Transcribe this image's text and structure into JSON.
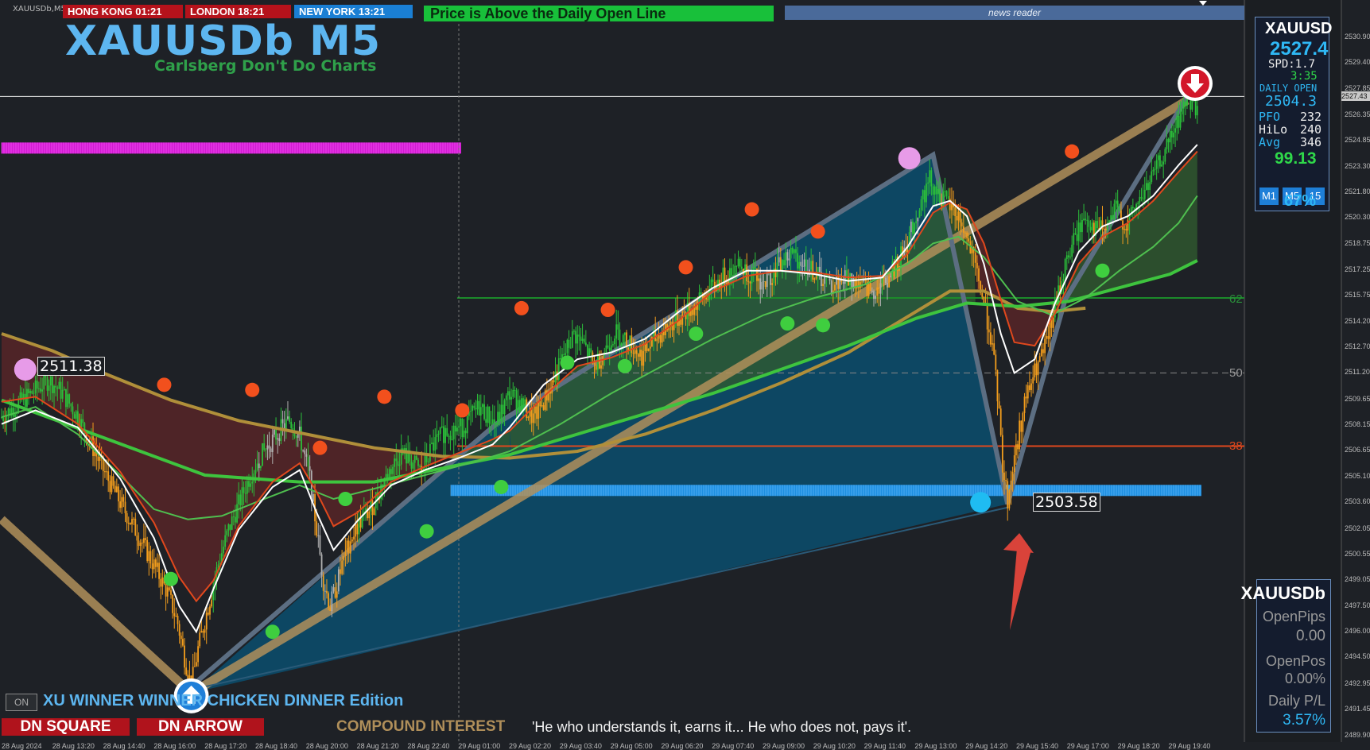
{
  "window": {
    "symbol_label": "XAUUSDb,M5"
  },
  "sessions": [
    {
      "label": "HONG KONG 01:21",
      "color": "#b5121b"
    },
    {
      "label": "LONDON  18:21",
      "color": "#b5121b"
    },
    {
      "label": "NEW YORK  13:21",
      "color": "#1a7fd4"
    }
  ],
  "status_text": "Price is Above the Daily Open Line",
  "news_reader": "news reader",
  "chart_title": "XAUUSDb M5",
  "chart_subtitle": "Carlsberg Don't Do Charts",
  "info_panel": {
    "symbol": "XAUUSD",
    "price": "2527.4",
    "spread": "SPD:1.7",
    "timer": "3:35",
    "daily_open_label": "DAILY OPEN",
    "daily_open_value": "2504.3",
    "pfo_label": "PFO",
    "pfo_value": "232",
    "hilo_label": "HiLo",
    "hilo_value": "240",
    "avg_label": "Avg",
    "avg_value": "346",
    "score": "99.13",
    "timeframes": [
      "M1",
      "M5",
      "15"
    ],
    "percent": "67%"
  },
  "position_panel": {
    "symbol": "XAUUSDb",
    "open_pips_label": "OpenPips",
    "open_pips_value": "0.00",
    "open_pos_label": "OpenPos",
    "open_pos_value": "0.00%",
    "daily_pl_label": "Daily P/L",
    "daily_pl_value": "3.57%"
  },
  "labels": {
    "swing_high": "2511.38",
    "swing_low": "2503.58"
  },
  "fib_levels": [
    "62",
    "50",
    "38"
  ],
  "bottom": {
    "on_button": "ON",
    "edition": "XU WINNER WINNER CHICKEN DINNER Edition",
    "dn_square": "DN SQUARE",
    "dn_arrow": "DN ARROW",
    "compound": "COMPOUND INTEREST",
    "quote": "'He who understands it, earns it... He who does not, pays it'."
  },
  "time_axis": [
    "28 Aug 2024",
    "28 Aug 13:20",
    "28 Aug 14:40",
    "28 Aug 16:00",
    "28 Aug 17:20",
    "28 Aug 18:40",
    "28 Aug 20:00",
    "28 Aug 21:20",
    "28 Aug 22:40",
    "29 Aug 01:00",
    "29 Aug 02:20",
    "29 Aug 03:40",
    "29 Aug 05:00",
    "29 Aug 06:20",
    "29 Aug 07:40",
    "29 Aug 09:00",
    "29 Aug 10:20",
    "29 Aug 11:40",
    "29 Aug 13:00",
    "29 Aug 14:20",
    "29 Aug 15:40",
    "29 Aug 17:00",
    "29 Aug 18:20",
    "29 Aug 19:40"
  ],
  "price_axis": [
    "2530.90",
    "2529.40",
    "2527.85",
    "2526.35",
    "2524.85",
    "2523.30",
    "2521.80",
    "2520.30",
    "2518.75",
    "2517.25",
    "2515.75",
    "2514.20",
    "2512.70",
    "2511.20",
    "2509.65",
    "2508.15",
    "2506.65",
    "2505.10",
    "2503.60",
    "2502.05",
    "2500.55",
    "2499.05",
    "2497.50",
    "2496.00",
    "2494.50",
    "2492.95",
    "2491.45",
    "2489.90"
  ],
  "current_price_tag": "2527.43",
  "chart_data": {
    "type": "candlestick",
    "symbol": "XAUUSDb",
    "timeframe": "M5",
    "ylim": [
      2489.9,
      2531.6
    ],
    "y_ticks": [
      2530.9,
      2529.4,
      2527.85,
      2526.35,
      2524.85,
      2523.3,
      2521.8,
      2520.3,
      2518.75,
      2517.25,
      2515.75,
      2514.2,
      2512.7,
      2511.2,
      2509.65,
      2508.15,
      2506.65,
      2505.1,
      2503.6,
      2502.05,
      2500.55,
      2499.05,
      2497.5,
      2496.0,
      2494.5,
      2492.95,
      2491.45,
      2489.9
    ],
    "close_path": [
      [
        0,
        2508.6
      ],
      [
        10,
        2509.4
      ],
      [
        20,
        2510.2
      ],
      [
        28,
        2510.8
      ],
      [
        36,
        2510.0
      ],
      [
        44,
        2508.8
      ],
      [
        52,
        2507.2
      ],
      [
        60,
        2505.5
      ],
      [
        70,
        2503.6
      ],
      [
        80,
        2501.8
      ],
      [
        90,
        2499.9
      ],
      [
        98,
        2498.3
      ],
      [
        104,
        2496.5
      ],
      [
        108,
        2494.5
      ],
      [
        112,
        2492.8
      ],
      [
        116,
        2495.0
      ],
      [
        122,
        2497.5
      ],
      [
        128,
        2500.0
      ],
      [
        134,
        2502.0
      ],
      [
        140,
        2503.5
      ],
      [
        146,
        2505.0
      ],
      [
        152,
        2506.2
      ],
      [
        158,
        2507.0
      ],
      [
        164,
        2507.8
      ],
      [
        170,
        2508.4
      ],
      [
        176,
        2507.5
      ],
      [
        182,
        2505.0
      ],
      [
        186,
        2502.0
      ],
      [
        190,
        2499.0
      ],
      [
        194,
        2497.5
      ],
      [
        200,
        2499.5
      ],
      [
        206,
        2501.5
      ],
      [
        212,
        2502.5
      ],
      [
        218,
        2503.2
      ],
      [
        224,
        2504.5
      ],
      [
        230,
        2505.6
      ],
      [
        236,
        2506.5
      ],
      [
        242,
        2506.0
      ],
      [
        248,
        2505.4
      ],
      [
        254,
        2506.8
      ],
      [
        262,
        2507.8
      ],
      [
        272,
        2508.0
      ],
      [
        282,
        2509.2
      ],
      [
        292,
        2508.2
      ],
      [
        300,
        2510.0
      ],
      [
        308,
        2509.2
      ],
      [
        314,
        2508.5
      ],
      [
        320,
        2509.5
      ],
      [
        326,
        2510.8
      ],
      [
        332,
        2512.2
      ],
      [
        338,
        2513.5
      ],
      [
        344,
        2512.8
      ],
      [
        350,
        2511.6
      ],
      [
        356,
        2512.5
      ],
      [
        362,
        2513.6
      ],
      [
        370,
        2513.0
      ],
      [
        378,
        2512.2
      ],
      [
        386,
        2513.2
      ],
      [
        394,
        2514.0
      ],
      [
        402,
        2514.6
      ],
      [
        410,
        2515.2
      ],
      [
        418,
        2516.0
      ],
      [
        426,
        2516.8
      ],
      [
        434,
        2517.6
      ],
      [
        442,
        2517.0
      ],
      [
        450,
        2516.4
      ],
      [
        458,
        2517.4
      ],
      [
        466,
        2518.2
      ],
      [
        474,
        2517.6
      ],
      [
        482,
        2516.9
      ],
      [
        490,
        2516.3
      ],
      [
        498,
        2516.8
      ],
      [
        506,
        2516.4
      ],
      [
        514,
        2516.0
      ],
      [
        522,
        2516.6
      ],
      [
        530,
        2517.8
      ],
      [
        536,
        2519.2
      ],
      [
        542,
        2521.0
      ],
      [
        548,
        2522.6
      ],
      [
        554,
        2521.6
      ],
      [
        560,
        2521.0
      ],
      [
        566,
        2520.2
      ],
      [
        572,
        2518.4
      ],
      [
        578,
        2516.2
      ],
      [
        584,
        2513.4
      ],
      [
        588,
        2510.0
      ],
      [
        591,
        2505.8
      ],
      [
        594,
        2503.7
      ],
      [
        598,
        2506.2
      ],
      [
        604,
        2509.4
      ],
      [
        610,
        2511.2
      ],
      [
        616,
        2512.6
      ],
      [
        622,
        2515.0
      ],
      [
        628,
        2517.5
      ],
      [
        634,
        2519.2
      ],
      [
        640,
        2520.4
      ],
      [
        646,
        2519.6
      ],
      [
        652,
        2519.6
      ],
      [
        658,
        2520.8
      ],
      [
        664,
        2519.8
      ],
      [
        670,
        2521.0
      ],
      [
        676,
        2522.0
      ],
      [
        682,
        2523.2
      ],
      [
        688,
        2524.4
      ],
      [
        694,
        2525.8
      ],
      [
        700,
        2527.4
      ],
      [
        706,
        2526.8
      ]
    ],
    "ma_white": [
      [
        0,
        2508.2
      ],
      [
        20,
        2509.0
      ],
      [
        45,
        2508.0
      ],
      [
        70,
        2505.0
      ],
      [
        90,
        2501.5
      ],
      [
        105,
        2497.5
      ],
      [
        115,
        2496.0
      ],
      [
        125,
        2498.5
      ],
      [
        140,
        2502.0
      ],
      [
        160,
        2504.5
      ],
      [
        176,
        2505.5
      ],
      [
        186,
        2503.0
      ],
      [
        196,
        2500.8
      ],
      [
        210,
        2502.5
      ],
      [
        230,
        2504.6
      ],
      [
        250,
        2505.5
      ],
      [
        270,
        2506.2
      ],
      [
        290,
        2507.0
      ],
      [
        300,
        2508.0
      ],
      [
        320,
        2510.5
      ],
      [
        340,
        2512.0
      ],
      [
        360,
        2512.4
      ],
      [
        380,
        2513.2
      ],
      [
        400,
        2514.8
      ],
      [
        420,
        2516.2
      ],
      [
        440,
        2517.2
      ],
      [
        460,
        2517.2
      ],
      [
        480,
        2517.0
      ],
      [
        500,
        2516.6
      ],
      [
        520,
        2516.8
      ],
      [
        535,
        2518.6
      ],
      [
        550,
        2521.0
      ],
      [
        560,
        2521.3
      ],
      [
        570,
        2520.4
      ],
      [
        580,
        2517.6
      ],
      [
        590,
        2513.5
      ],
      [
        598,
        2511.2
      ],
      [
        610,
        2512.0
      ],
      [
        622,
        2515.3
      ],
      [
        636,
        2518.3
      ],
      [
        650,
        2519.8
      ],
      [
        665,
        2520.4
      ],
      [
        680,
        2521.6
      ],
      [
        695,
        2523.4
      ],
      [
        706,
        2524.6
      ]
    ],
    "ma_orange": [
      [
        0,
        2509.5
      ],
      [
        20,
        2509.8
      ],
      [
        45,
        2508.2
      ],
      [
        70,
        2505.4
      ],
      [
        90,
        2502.4
      ],
      [
        105,
        2499.2
      ],
      [
        115,
        2497.8
      ],
      [
        125,
        2499.0
      ],
      [
        140,
        2502.2
      ],
      [
        160,
        2504.8
      ],
      [
        176,
        2505.9
      ],
      [
        186,
        2504.2
      ],
      [
        196,
        2502.2
      ],
      [
        210,
        2503.0
      ],
      [
        230,
        2504.8
      ],
      [
        250,
        2505.7
      ],
      [
        270,
        2506.5
      ],
      [
        290,
        2507.3
      ],
      [
        300,
        2507.8
      ],
      [
        320,
        2509.8
      ],
      [
        340,
        2511.6
      ],
      [
        360,
        2512.1
      ],
      [
        380,
        2512.9
      ],
      [
        400,
        2514.3
      ],
      [
        420,
        2516.0
      ],
      [
        440,
        2516.9
      ],
      [
        460,
        2517.2
      ],
      [
        480,
        2517.1
      ],
      [
        500,
        2516.8
      ],
      [
        520,
        2516.9
      ],
      [
        535,
        2518.2
      ],
      [
        550,
        2520.6
      ],
      [
        560,
        2521.2
      ],
      [
        570,
        2520.8
      ],
      [
        580,
        2518.8
      ],
      [
        590,
        2515.5
      ],
      [
        598,
        2513.0
      ],
      [
        610,
        2512.8
      ],
      [
        622,
        2514.7
      ],
      [
        636,
        2517.6
      ],
      [
        650,
        2519.2
      ],
      [
        665,
        2520.0
      ],
      [
        680,
        2521.3
      ],
      [
        695,
        2523.0
      ],
      [
        706,
        2524.2
      ]
    ],
    "ma_green_mid": [
      [
        0,
        2508.6
      ],
      [
        20,
        2509.2
      ],
      [
        45,
        2507.6
      ],
      [
        70,
        2505.2
      ],
      [
        90,
        2503.2
      ],
      [
        110,
        2502.6
      ],
      [
        130,
        2502.8
      ],
      [
        150,
        2503.6
      ],
      [
        176,
        2504.6
      ],
      [
        196,
        2503.8
      ],
      [
        220,
        2504.4
      ],
      [
        250,
        2505.2
      ],
      [
        280,
        2506.0
      ],
      [
        300,
        2506.6
      ],
      [
        330,
        2508.2
      ],
      [
        360,
        2510.0
      ],
      [
        390,
        2511.6
      ],
      [
        420,
        2513.2
      ],
      [
        450,
        2514.6
      ],
      [
        480,
        2515.6
      ],
      [
        510,
        2516.4
      ],
      [
        535,
        2517.6
      ],
      [
        550,
        2518.8
      ],
      [
        565,
        2519.2
      ],
      [
        580,
        2518.0
      ],
      [
        600,
        2515.4
      ],
      [
        620,
        2514.6
      ],
      [
        640,
        2515.6
      ],
      [
        660,
        2517.2
      ],
      [
        680,
        2518.6
      ],
      [
        695,
        2520.0
      ],
      [
        706,
        2521.6
      ]
    ],
    "ma_green_slow": [
      [
        0,
        2509.6
      ],
      [
        60,
        2507.4
      ],
      [
        120,
        2505.2
      ],
      [
        176,
        2504.8
      ],
      [
        220,
        2504.8
      ],
      [
        260,
        2505.6
      ],
      [
        300,
        2506.4
      ],
      [
        340,
        2507.6
      ],
      [
        380,
        2508.8
      ],
      [
        420,
        2510.0
      ],
      [
        460,
        2511.4
      ],
      [
        500,
        2512.8
      ],
      [
        540,
        2514.4
      ],
      [
        570,
        2515.3
      ],
      [
        600,
        2515.1
      ],
      [
        630,
        2515.4
      ],
      [
        660,
        2516.2
      ],
      [
        690,
        2517.0
      ],
      [
        706,
        2517.8
      ]
    ],
    "ma_brown": [
      [
        0,
        2513.5
      ],
      [
        30,
        2512.5
      ],
      [
        60,
        2511.2
      ],
      [
        100,
        2509.6
      ],
      [
        140,
        2508.4
      ],
      [
        180,
        2507.6
      ],
      [
        220,
        2506.8
      ],
      [
        260,
        2506.3
      ],
      [
        300,
        2506.2
      ],
      [
        340,
        2506.6
      ],
      [
        380,
        2507.6
      ],
      [
        420,
        2509.0
      ],
      [
        460,
        2510.6
      ],
      [
        500,
        2512.4
      ],
      [
        530,
        2514.2
      ],
      [
        560,
        2516.0
      ],
      [
        580,
        2516.0
      ],
      [
        600,
        2515.0
      ],
      [
        620,
        2514.8
      ],
      [
        640,
        2515.0
      ]
    ],
    "swing_zigzag": [
      [
        112,
        2492.8
      ],
      [
        292,
        2508.2
      ],
      [
        550,
        2524.0
      ],
      [
        594,
        2503.5
      ],
      [
        628,
        2515.5
      ],
      [
        700,
        2527.4
      ]
    ],
    "wedge_upper": [
      [
        0,
        2502.6
      ],
      [
        112,
        2492.4
      ],
      [
        700,
        2527.2
      ]
    ],
    "wedge_lower": [
      [
        112,
        2492.6
      ],
      [
        594,
        2503.3
      ]
    ],
    "swing_highs": [
      [
        14,
        2511.4
      ],
      [
        96,
        2510.5
      ],
      [
        148,
        2510.2
      ],
      [
        188,
        2506.8
      ],
      [
        226,
        2509.8
      ],
      [
        272,
        2509.0
      ],
      [
        307,
        2515.0
      ],
      [
        358,
        2514.9
      ],
      [
        404,
        2517.4
      ],
      [
        443,
        2520.8
      ],
      [
        482,
        2519.5
      ],
      [
        632,
        2524.2
      ]
    ],
    "swing_lows": [
      [
        100,
        2499.1
      ],
      [
        160,
        2496.0
      ],
      [
        203,
        2503.8
      ],
      [
        251,
        2501.9
      ],
      [
        295,
        2504.5
      ],
      [
        334,
        2511.8
      ],
      [
        368,
        2511.6
      ],
      [
        410,
        2513.5
      ],
      [
        464,
        2514.1
      ],
      [
        485,
        2514.0
      ],
      [
        650,
        2517.2
      ]
    ],
    "pink_markers": [
      [
        14,
        2511.4
      ],
      [
        536,
        2523.8
      ]
    ],
    "cyan_marker": [
      578,
      2503.6
    ],
    "daily_open_line": 2504.3,
    "fib_62": 2515.6,
    "fib_50": 2511.2,
    "fib_38": 2506.9,
    "magenta_band_value": 2524.4,
    "annotations": [
      "2511.38",
      "2503.58"
    ]
  }
}
